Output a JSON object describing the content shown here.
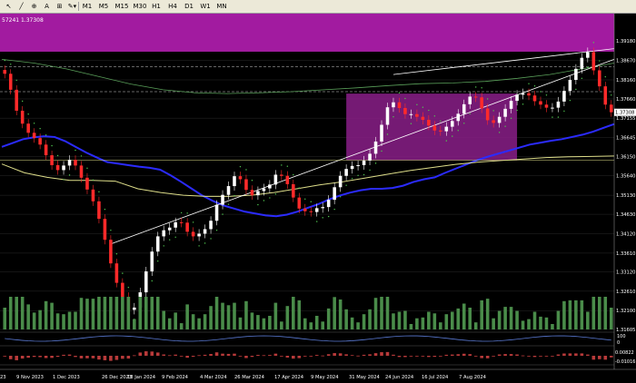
{
  "toolbar": {
    "tools": [
      {
        "glyph": "↖",
        "name": "cursor-icon"
      },
      {
        "glyph": "╱",
        "name": "trendline-icon"
      },
      {
        "glyph": "⊕",
        "name": "crosshair-icon"
      },
      {
        "glyph": "A",
        "name": "text-tool-icon"
      },
      {
        "glyph": "⊞",
        "name": "label-icon"
      },
      {
        "glyph": "✎▾",
        "name": "shapes-dropdown-icon"
      }
    ],
    "timeframes": [
      "M1",
      "M5",
      "M15",
      "M30",
      "H1",
      "H4",
      "D1",
      "W1",
      "MN"
    ]
  },
  "chart_data": {
    "type": "candlestick",
    "price_header": "57241 1.37308",
    "current_price_label": "1.37308",
    "price_ticks": [
      "1.39180",
      "1.38670",
      "1.38160",
      "1.37660",
      "1.37155",
      "1.36645",
      "1.36150",
      "1.35640",
      "1.35130",
      "1.34630",
      "1.34120",
      "1.33610",
      "1.33120",
      "1.32610",
      "1.32100",
      "1.31605"
    ],
    "date_ticks": [
      "23",
      "9 Nov 2023",
      "1 Dec 2023",
      "26 Dec 2023",
      "18 Jan 2024",
      "9 Feb 2024",
      "4 Mar 2024",
      "26 Mar 2024",
      "17 Apr 2024",
      "9 May 2024",
      "31 May 2024",
      "24 Jun 2024",
      "16 Jul 2024",
      "7 Aug 2024"
    ],
    "ylim": [
      1.31605,
      1.399
    ],
    "closes": [
      1.3832,
      1.379,
      1.3735,
      1.3701,
      1.3677,
      1.3663,
      1.3646,
      1.3618,
      1.3592,
      1.3579,
      1.3591,
      1.3606,
      1.3591,
      1.3559,
      1.3528,
      1.3497,
      1.3451,
      1.3396,
      1.3334,
      1.3283,
      1.3246,
      1.3212,
      1.3218,
      1.3258,
      1.3313,
      1.3365,
      1.3405,
      1.3421,
      1.3428,
      1.3442,
      1.3441,
      1.3417,
      1.3405,
      1.3412,
      1.3424,
      1.3446,
      1.3488,
      1.3514,
      1.3537,
      1.3563,
      1.3555,
      1.3527,
      1.3513,
      1.3524,
      1.3531,
      1.3541,
      1.3567,
      1.3564,
      1.3542,
      1.3507,
      1.3478,
      1.3471,
      1.3469,
      1.3479,
      1.3482,
      1.3501,
      1.3534,
      1.3564,
      1.3582,
      1.359,
      1.3592,
      1.3604,
      1.3622,
      1.3654,
      1.3698,
      1.3744,
      1.3757,
      1.3742,
      1.3726,
      1.3726,
      1.3719,
      1.3711,
      1.3696,
      1.3683,
      1.3681,
      1.3693,
      1.3708,
      1.3727,
      1.3752,
      1.3772,
      1.377,
      1.3741,
      1.371,
      1.3703,
      1.3719,
      1.374,
      1.3761,
      1.3777,
      1.3781,
      1.3775,
      1.376,
      1.3751,
      1.3743,
      1.3743,
      1.3759,
      1.3787,
      1.3816,
      1.3845,
      1.3874,
      1.3889,
      1.3841,
      1.3799,
      1.3751,
      1.3731
    ],
    "blue_ma": [
      1.364,
      1.365,
      1.366,
      1.3665,
      1.3668,
      1.3666,
      1.3655,
      1.364,
      1.3625,
      1.3612,
      1.36,
      1.3596,
      1.3592,
      1.3588,
      1.3585,
      1.358,
      1.3565,
      1.3548,
      1.353,
      1.3512,
      1.3498,
      1.3486,
      1.3478,
      1.347,
      1.3465,
      1.346,
      1.3458,
      1.3462,
      1.347,
      1.348,
      1.349,
      1.3502,
      1.3512,
      1.352,
      1.3526,
      1.353,
      1.353,
      1.3532,
      1.3538,
      1.3548,
      1.3555,
      1.356,
      1.3572,
      1.3583,
      1.3594,
      1.3605,
      1.3614,
      1.3622,
      1.363,
      1.3638,
      1.3646,
      1.3651,
      1.3656,
      1.366,
      1.3666,
      1.3672,
      1.368,
      1.369,
      1.37
    ],
    "yellow_ma": [
      1.3595,
      1.3572,
      1.356,
      1.3552,
      1.3552,
      1.355,
      1.353,
      1.352,
      1.3513,
      1.351,
      1.351,
      1.3513,
      1.352,
      1.353,
      1.354,
      1.3548,
      1.3558,
      1.3568,
      1.3578,
      1.3586,
      1.3594,
      1.36,
      1.3604,
      1.3608,
      1.3612,
      1.3614,
      1.3615,
      1.3616
    ],
    "green_bb": [
      1.387,
      1.386,
      1.3845,
      1.3825,
      1.3805,
      1.379,
      1.3782,
      1.378,
      1.3782,
      1.3785,
      1.379,
      1.3795,
      1.3801,
      1.3806,
      1.3808,
      1.3812,
      1.382,
      1.383,
      1.3845,
      1.386
    ],
    "purple_band": [
      1.389,
      1.399
    ],
    "range_box": [
      1.3605,
      1.378
    ],
    "support_level": 1.3605,
    "resistance_levels": [
      1.385,
      1.3785
    ],
    "volume_ticks": [],
    "osc1_ticks": [
      "100",
      "0"
    ],
    "osc2_ticks": [
      "0.00822",
      "-0.01016"
    ],
    "colors": {
      "bull": "#ffffff",
      "bear": "#ff2a2a",
      "blue_ma": "#2b2bff",
      "yellow_ma": "#dede8a",
      "bb": "#5aa05a",
      "sar": "#50c850",
      "band": "#a21ba0",
      "box": "#8a1f88",
      "volume": "#4a8c4a",
      "grid": "#2a2a2a"
    }
  }
}
